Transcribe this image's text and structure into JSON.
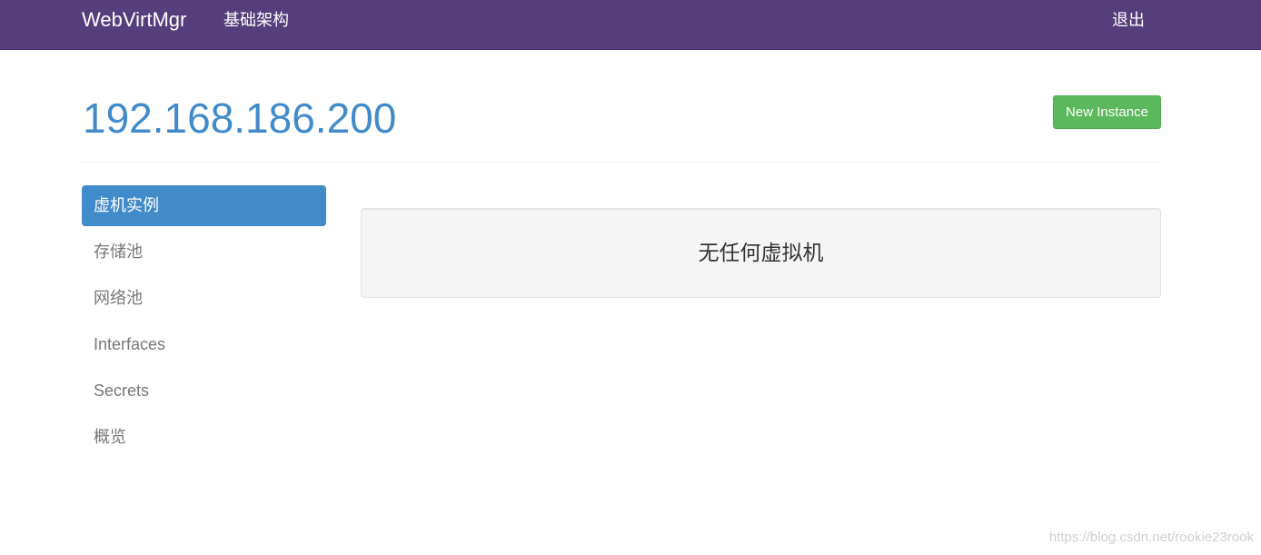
{
  "navbar": {
    "brand": "WebVirtMgr",
    "infrastructure_link": "基础架构",
    "logout_link": "退出"
  },
  "page": {
    "title": "192.168.186.200",
    "new_instance_button": "New Instance"
  },
  "sidebar": {
    "items": [
      {
        "label": "虚机实例",
        "active": true
      },
      {
        "label": "存储池",
        "active": false
      },
      {
        "label": "网络池",
        "active": false
      },
      {
        "label": "Interfaces",
        "active": false
      },
      {
        "label": "Secrets",
        "active": false
      },
      {
        "label": "概览",
        "active": false
      }
    ]
  },
  "main": {
    "empty_message": "无任何虚拟机"
  },
  "watermark": "https://blog.csdn.net/rookie23rook",
  "colors": {
    "navbar": "#563d7c",
    "accent": "#428bca",
    "success": "#5cb85c"
  }
}
